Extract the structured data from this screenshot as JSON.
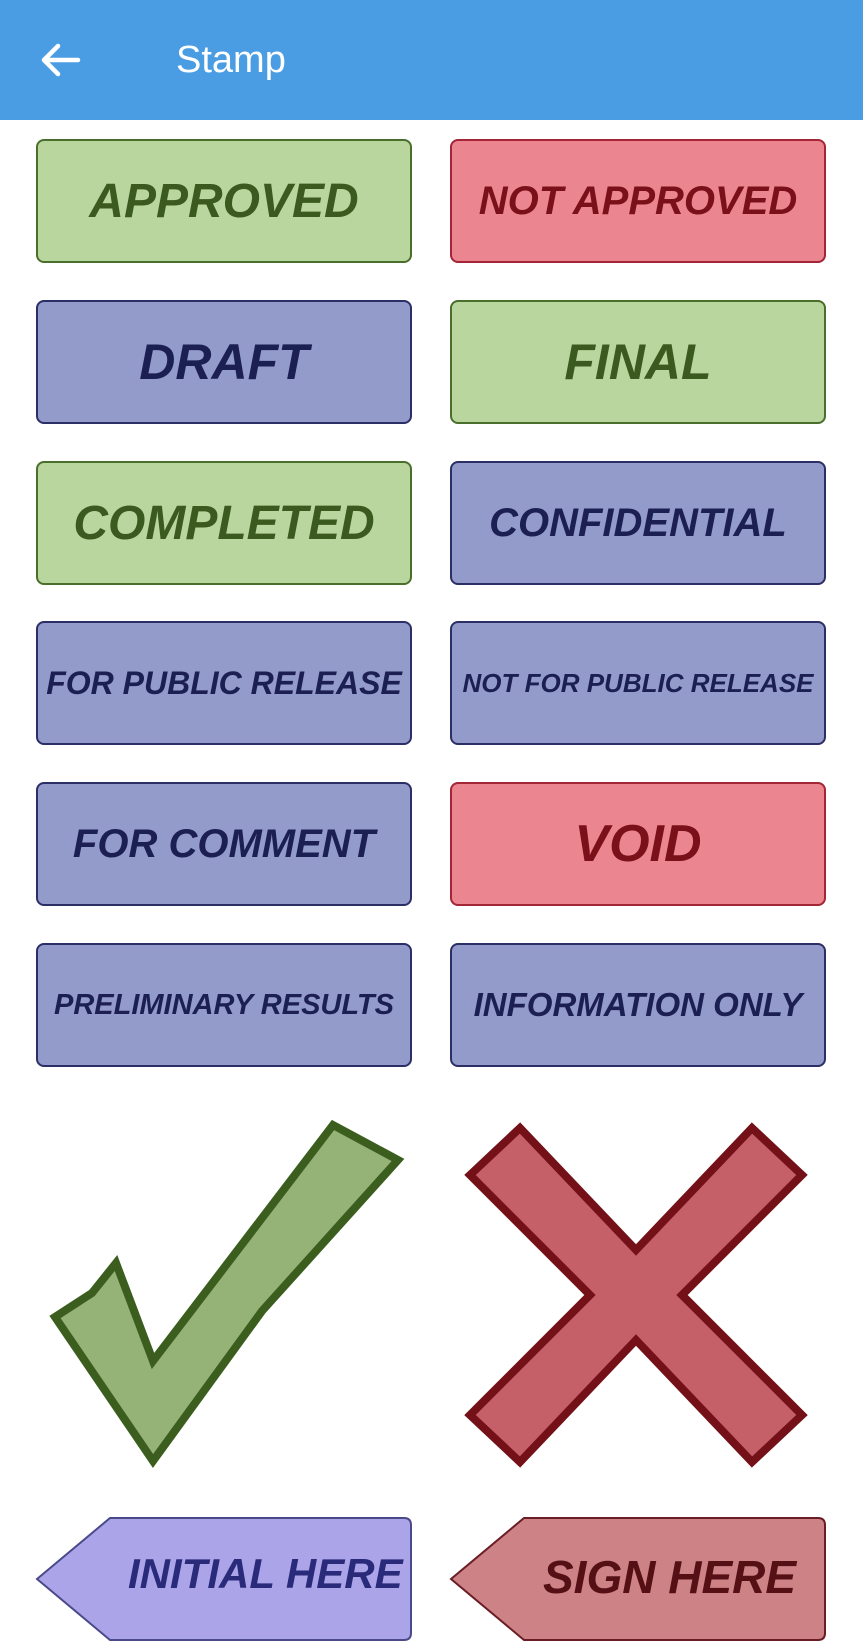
{
  "app_bar": {
    "title": "Stamp",
    "back_icon": "arrow-left-icon"
  },
  "stamps": [
    {
      "label": "APPROVED",
      "color": "green"
    },
    {
      "label": "NOT APPROVED",
      "color": "red"
    },
    {
      "label": "DRAFT",
      "color": "blue"
    },
    {
      "label": "FINAL",
      "color": "green"
    },
    {
      "label": "COMPLETED",
      "color": "green"
    },
    {
      "label": "CONFIDENTIAL",
      "color": "blue"
    },
    {
      "label": "FOR PUBLIC RELEASE",
      "color": "blue"
    },
    {
      "label": "NOT FOR PUBLIC RELEASE",
      "color": "blue"
    },
    {
      "label": "FOR COMMENT",
      "color": "blue"
    },
    {
      "label": "VOID",
      "color": "red"
    },
    {
      "label": "PRELIMINARY RESULTS",
      "color": "blue"
    },
    {
      "label": "INFORMATION ONLY",
      "color": "blue"
    }
  ],
  "symbols": {
    "check": "checkmark-icon",
    "cross": "cross-icon"
  },
  "sign_stamps": {
    "initial": "INITIAL HERE",
    "sign": "SIGN HERE"
  },
  "colors": {
    "app_bar": "#4a9de3",
    "green_fill": "#bad69f",
    "red_fill": "#eb8690",
    "blue_fill": "#939bcb",
    "check_fill": "#95b277",
    "cross_fill": "#c55f68",
    "initial_fill": "#aca4e8",
    "sign_fill": "#cd8286"
  }
}
